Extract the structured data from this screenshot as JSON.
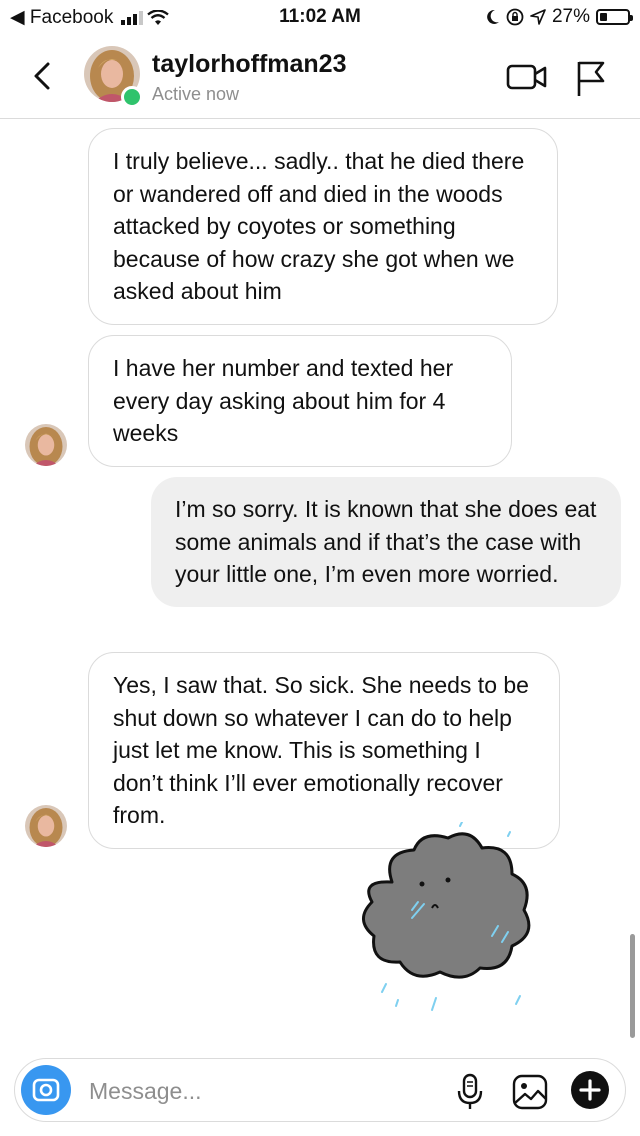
{
  "status_bar": {
    "back_app": "◀ Facebook",
    "time": "11:02 AM",
    "battery": "27%"
  },
  "header": {
    "username": "taylorhoffman23",
    "presence": "Active now"
  },
  "messages": [
    {
      "sender": "them",
      "text": "I truly believe... sadly.. that he died there or wandered off and died in the woods attacked by coyotes or something because of how crazy she got when we asked about him"
    },
    {
      "sender": "them",
      "text": "I have her number and texted her every day asking about him for 4 weeks"
    },
    {
      "sender": "me",
      "text": "I’m so sorry. It is known that she does eat some animals and if that’s the case with your little one, I’m even more worried."
    },
    {
      "sender": "them",
      "text": "Yes, I saw that. So sick. She needs to be shut down so whatever I can do to help just let me know. This is something I don’t think I’ll ever emotionally recover from."
    }
  ],
  "sticker": {
    "description_icon": "sad-rain-cloud-sticker"
  },
  "composer": {
    "placeholder": "Message...",
    "icons": [
      "camera-icon",
      "microphone-icon",
      "gallery-icon",
      "plus-icon"
    ]
  },
  "colors": {
    "accent": "#3897f0",
    "online": "#2fc36c",
    "sent_bubble": "#efefef",
    "border": "#dbdbdb",
    "muted_text": "#8e8e8e"
  }
}
